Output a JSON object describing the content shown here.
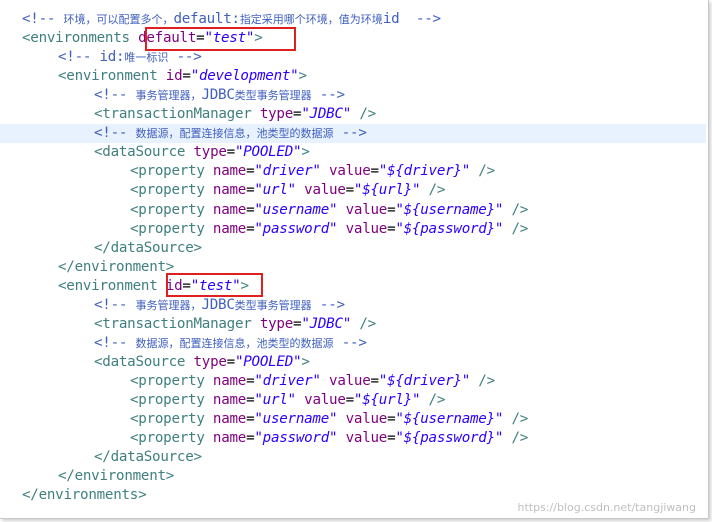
{
  "editor": {
    "lines": [
      [
        [
          "com",
          "<!-- "
        ],
        [
          "com-cjk",
          "环境，可以配置多个，"
        ],
        [
          "com",
          "default:"
        ],
        [
          "com-cjk",
          "指定采用哪个环境，值为环境"
        ],
        [
          "com",
          "id  -->"
        ]
      ],
      [
        [
          "tag",
          "<environments "
        ],
        [
          "attr",
          "default"
        ],
        [
          "eq",
          "="
        ],
        [
          "val",
          "\"test\""
        ],
        [
          "tag",
          ">"
        ]
      ],
      [
        [
          "com",
          "<!-- id:"
        ],
        [
          "com-cjk",
          "唯一标识"
        ],
        [
          "com",
          " -->"
        ]
      ],
      [
        [
          "tag",
          "<environment "
        ],
        [
          "attr",
          "id"
        ],
        [
          "eq",
          "="
        ],
        [
          "val",
          "\"development\""
        ],
        [
          "tag",
          ">"
        ]
      ],
      [
        [
          "com",
          "<!-- "
        ],
        [
          "com-cjk",
          "事务管理器，"
        ],
        [
          "com",
          "JDBC"
        ],
        [
          "com-cjk",
          "类型事务管理器"
        ],
        [
          "com",
          " -->"
        ]
      ],
      [
        [
          "tag",
          "<transactionManager "
        ],
        [
          "attr",
          "type"
        ],
        [
          "eq",
          "="
        ],
        [
          "val",
          "\"JDBC\""
        ],
        [
          "tag",
          " />"
        ]
      ],
      [
        [
          "com",
          "<!-- "
        ],
        [
          "com-cjk",
          "数据源，配置连接信息，池类型的数据源"
        ],
        [
          "com",
          " -->"
        ]
      ],
      [
        [
          "tag",
          "<dataSource "
        ],
        [
          "attr",
          "type"
        ],
        [
          "eq",
          "="
        ],
        [
          "val",
          "\"POOLED\""
        ],
        [
          "tag",
          ">"
        ]
      ],
      [
        [
          "tag",
          "<property "
        ],
        [
          "attr",
          "name"
        ],
        [
          "eq",
          "="
        ],
        [
          "val",
          "\"driver\""
        ],
        [
          "tag",
          " "
        ],
        [
          "attr",
          "value"
        ],
        [
          "eq",
          "="
        ],
        [
          "val",
          "\"${driver}\""
        ],
        [
          "tag",
          " />"
        ]
      ],
      [
        [
          "tag",
          "<property "
        ],
        [
          "attr",
          "name"
        ],
        [
          "eq",
          "="
        ],
        [
          "val",
          "\"url\""
        ],
        [
          "tag",
          " "
        ],
        [
          "attr",
          "value"
        ],
        [
          "eq",
          "="
        ],
        [
          "val",
          "\"${url}\""
        ],
        [
          "tag",
          " />"
        ]
      ],
      [
        [
          "tag",
          "<property "
        ],
        [
          "attr",
          "name"
        ],
        [
          "eq",
          "="
        ],
        [
          "val",
          "\"username\""
        ],
        [
          "tag",
          " "
        ],
        [
          "attr",
          "value"
        ],
        [
          "eq",
          "="
        ],
        [
          "val",
          "\"${username}\""
        ],
        [
          "tag",
          " />"
        ]
      ],
      [
        [
          "tag",
          "<property "
        ],
        [
          "attr",
          "name"
        ],
        [
          "eq",
          "="
        ],
        [
          "val",
          "\"password\""
        ],
        [
          "tag",
          " "
        ],
        [
          "attr",
          "value"
        ],
        [
          "eq",
          "="
        ],
        [
          "val",
          "\"${password}\""
        ],
        [
          "tag",
          " />"
        ]
      ],
      [
        [
          "tag",
          "</dataSource>"
        ]
      ],
      [
        [
          "tag",
          "</environment>"
        ]
      ],
      [
        [
          "tag",
          "<environment "
        ],
        [
          "attr",
          "id"
        ],
        [
          "eq",
          "="
        ],
        [
          "val",
          "\"test\""
        ],
        [
          "tag",
          ">"
        ]
      ],
      [
        [
          "com",
          "<!-- "
        ],
        [
          "com-cjk",
          "事务管理器，"
        ],
        [
          "com",
          "JDBC"
        ],
        [
          "com-cjk",
          "类型事务管理器"
        ],
        [
          "com",
          " -->"
        ]
      ],
      [
        [
          "tag",
          "<transactionManager "
        ],
        [
          "attr",
          "type"
        ],
        [
          "eq",
          "="
        ],
        [
          "val",
          "\"JDBC\""
        ],
        [
          "tag",
          " />"
        ]
      ],
      [
        [
          "com",
          "<!-- "
        ],
        [
          "com-cjk",
          "数据源，配置连接信息，池类型的数据源"
        ],
        [
          "com",
          " -->"
        ]
      ],
      [
        [
          "tag",
          "<dataSource "
        ],
        [
          "attr",
          "type"
        ],
        [
          "eq",
          "="
        ],
        [
          "val",
          "\"POOLED\""
        ],
        [
          "tag",
          ">"
        ]
      ],
      [
        [
          "tag",
          "<property "
        ],
        [
          "attr",
          "name"
        ],
        [
          "eq",
          "="
        ],
        [
          "val",
          "\"driver\""
        ],
        [
          "tag",
          " "
        ],
        [
          "attr",
          "value"
        ],
        [
          "eq",
          "="
        ],
        [
          "val",
          "\"${driver}\""
        ],
        [
          "tag",
          " />"
        ]
      ],
      [
        [
          "tag",
          "<property "
        ],
        [
          "attr",
          "name"
        ],
        [
          "eq",
          "="
        ],
        [
          "val",
          "\"url\""
        ],
        [
          "tag",
          " "
        ],
        [
          "attr",
          "value"
        ],
        [
          "eq",
          "="
        ],
        [
          "val",
          "\"${url}\""
        ],
        [
          "tag",
          " />"
        ]
      ],
      [
        [
          "tag",
          "<property "
        ],
        [
          "attr",
          "name"
        ],
        [
          "eq",
          "="
        ],
        [
          "val",
          "\"username\""
        ],
        [
          "tag",
          " "
        ],
        [
          "attr",
          "value"
        ],
        [
          "eq",
          "="
        ],
        [
          "val",
          "\"${username}\""
        ],
        [
          "tag",
          " />"
        ]
      ],
      [
        [
          "tag",
          "<property "
        ],
        [
          "attr",
          "name"
        ],
        [
          "eq",
          "="
        ],
        [
          "val",
          "\"password\""
        ],
        [
          "tag",
          " "
        ],
        [
          "attr",
          "value"
        ],
        [
          "eq",
          "="
        ],
        [
          "val",
          "\"${password}\""
        ],
        [
          "tag",
          " />"
        ]
      ],
      [
        [
          "tag",
          "</dataSource>"
        ]
      ],
      [
        [
          "tag",
          "</environment>"
        ]
      ],
      [
        [
          "tag",
          "</environments>"
        ]
      ]
    ],
    "highlighted_line": 6
  },
  "watermark": "https://blog.csdn.net/tangjiwang",
  "colors": {
    "tag": "#3f7f7f",
    "attribute": "#7f007f",
    "value": "#2a00ff",
    "comment": "#3f5fbf",
    "current_line": "#e8f2fe",
    "annotation_box": "#e02020"
  }
}
